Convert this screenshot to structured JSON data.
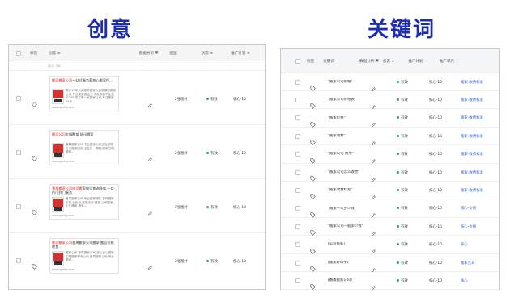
{
  "headings": {
    "left": "创意",
    "right": "关键词"
  },
  "left": {
    "columns": {
      "tag": "标签",
      "creative": "创意 ≑",
      "data": "数据分析",
      "type": "配图",
      "status": "状态 ≑",
      "plan": "推广计划 ≑"
    },
    "summary": {
      "label": "总计-30",
      "dash1": "-",
      "dash2": "-",
      "dash3": "-",
      "dash4": "-",
      "dash5": "-"
    },
    "rows": [
      {
        "title_red": "搬家搬家公司",
        "title_rest": "一站式服务要放心搬家找…",
        "desc": "累计10年大家服务搬家大量规模的搬家公司,专业搬家搬运工,不乱收费不乱加价24年成立第一家搬家公司,专注搬家24年",
        "url": "www.gzrity.com",
        "type": "2张图片",
        "status": "有效",
        "plan": "核心-10"
      },
      {
        "title_red": "搬家公司",
        "title_rest": "全城覆盖 极迅搬家",
        "desc": "番禺搬家公司 专业搬家公司全包服务 专业搬家团队,全包价一周搬,搬家日期,搬家…",
        "url": "www.gzrity.com",
        "type": "2张图片",
        "status": "有效",
        "plan": "核心-10"
      },
      {
        "title_red": "番禺搬家公司电话搬",
        "title_rest": "家电话查询致电,一口价门到门服务",
        "desc": "番禺搬家公司 专业搬家团队 多种搬家车型,全包价,优惠活动 搬家,公司搬家,企业搬家,搬家…",
        "url": "www.gzrity.com",
        "type": "2张图片",
        "status": "有效",
        "plan": "核心-10"
      },
      {
        "title_red": "搬家搬家公司",
        "title_rest": "番禺搬家公司搬家 搬运价格收费…",
        "desc": "搬家公司 番禺搬家公司 放心省心搬家 正规搬家服务公司 番禺搬家公司 专业搬家…",
        "url": "www.gzrity.com",
        "type": "2张图片",
        "status": "有效",
        "plan": "核心-10"
      }
    ]
  },
  "right": {
    "columns": {
      "tag": "标签",
      "keyword": "关键词",
      "data": "数据分析",
      "status": "状态 ≑",
      "plan": "推广计划",
      "unit": "推广单元"
    },
    "rows": [
      {
        "keyword": "\"搬家公司价格\"",
        "status": "有效",
        "plan": "核心-10",
        "unit": "搬家-收费标准"
      },
      {
        "keyword": "\"搬家公司价格表\"",
        "status": "有效",
        "plan": "核心-10",
        "unit": "搬家-收费标准"
      },
      {
        "keyword": "\"搬家价格\"",
        "status": "有效",
        "plan": "核心-10",
        "unit": "搬家-收费标准"
      },
      {
        "keyword": "\"搬家收费\"",
        "status": "有效",
        "plan": "核心-10",
        "unit": "搬家-收费标准"
      },
      {
        "keyword": "\"搬家公司 费用\"",
        "status": "有效",
        "plan": "核心-10",
        "unit": "搬家-收费标准"
      },
      {
        "keyword": "\"搬家公司怎么收费\"",
        "status": "有效",
        "plan": "核心-10",
        "unit": "搬家-收费标准"
      },
      {
        "keyword": "\"搬家收费标准\"",
        "status": "有效",
        "plan": "核心-10",
        "unit": "搬家-收费标准"
      },
      {
        "keyword": "\"搬家一次多少钱\"",
        "status": "有效",
        "plan": "核心-10",
        "unit": "核心-价格"
      },
      {
        "keyword": "\"搬家公司一般多少钱\"",
        "status": "有效",
        "plan": "核心-10",
        "unit": "核心-价格"
      },
      {
        "keyword": "[公司搬家]",
        "status": "有效",
        "plan": "核心-10",
        "unit": "核心"
      },
      {
        "keyword": "[搬家好日子]",
        "status": "有效",
        "plan": "核心-10",
        "unit": "搬家吉日"
      },
      {
        "keyword": "[番禺搬家公司]",
        "status": "有效",
        "plan": "核心-10",
        "unit": "核心"
      }
    ]
  }
}
